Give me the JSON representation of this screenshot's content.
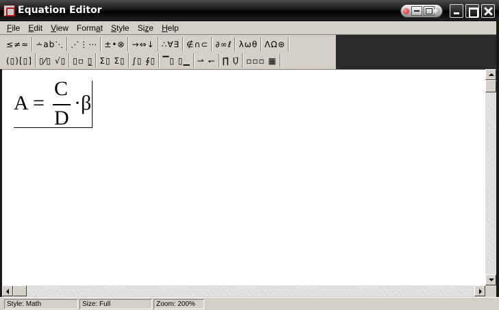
{
  "window": {
    "title": "Equation Editor"
  },
  "menu": [
    {
      "pre": "",
      "acc": "F",
      "post": "ile"
    },
    {
      "pre": "",
      "acc": "E",
      "post": "dit"
    },
    {
      "pre": "",
      "acc": "V",
      "post": "iew"
    },
    {
      "pre": "Form",
      "acc": "a",
      "post": "t"
    },
    {
      "pre": "",
      "acc": "S",
      "post": "tyle"
    },
    {
      "pre": "Si",
      "acc": "z",
      "post": "e"
    },
    {
      "pre": "",
      "acc": "H",
      "post": "elp"
    }
  ],
  "toolbar_row1": [
    {
      "name": "relational-symbols-button",
      "label": "≤≠≈"
    },
    {
      "name": "spaces-ellipses-button",
      "label": "∸ab⋱"
    },
    {
      "name": "embellishments-button",
      "label": "⋰⋮⋯"
    },
    {
      "name": "operator-symbols-button",
      "label": "±•⊗"
    },
    {
      "name": "arrow-symbols-button",
      "label": "→⇔↓"
    },
    {
      "name": "logical-symbols-button",
      "label": "∴∀∃"
    },
    {
      "name": "set-theory-symbols-button",
      "label": "∉∩⊂"
    },
    {
      "name": "misc-symbols-button",
      "label": "∂∞ℓ"
    },
    {
      "name": "greek-lowercase-button",
      "label": "λωθ"
    },
    {
      "name": "greek-uppercase-button",
      "label": "ΛΩ⊛"
    }
  ],
  "toolbar_row2": [
    {
      "name": "fence-templates-button",
      "label": "(▯)[▯]"
    },
    {
      "name": "fraction-radical-templates-button",
      "label": "▯⁄▯ √▯"
    },
    {
      "name": "subscript-superscript-templates-button",
      "label": "▯▫ ▯̲"
    },
    {
      "name": "summation-templates-button",
      "label": "Σ▯ Σ▯"
    },
    {
      "name": "integral-templates-button",
      "label": "∫▯ ∮▯"
    },
    {
      "name": "underbar-overbar-templates-button",
      "label": "▔▯ ▯▁"
    },
    {
      "name": "labeled-arrow-templates-button",
      "label": "⇀ ↽"
    },
    {
      "name": "products-set-theory-templates-button",
      "label": "∏̈ Ụ̈"
    },
    {
      "name": "matrix-templates-button",
      "label": "▫▫▫ ▦"
    }
  ],
  "equation": {
    "lhs": "A",
    "equals": "=",
    "numerator": "C",
    "denominator": "D",
    "operator": "·",
    "rhs_symbol": "β"
  },
  "status": {
    "style": "Style: Math",
    "size": "Size: Full",
    "zoom": "Zoom: 200%"
  }
}
